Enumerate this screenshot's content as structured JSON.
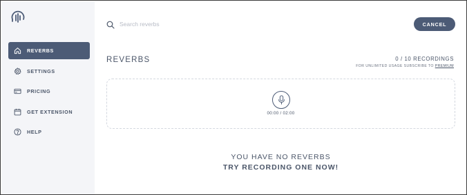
{
  "sidebar": {
    "logo_icon": "waveform-headset-icon",
    "items": [
      {
        "label": "REVERBS",
        "icon": "home-icon",
        "active": true
      },
      {
        "label": "SETTINGS",
        "icon": "gear-icon",
        "active": false
      },
      {
        "label": "PRICING",
        "icon": "credit-card-icon",
        "active": false
      },
      {
        "label": "GET EXTENSION",
        "icon": "calendar-icon",
        "active": false
      },
      {
        "label": "HELP",
        "icon": "question-circle-icon",
        "active": false
      }
    ]
  },
  "header": {
    "search_placeholder": "Search reverbs",
    "cancel_label": "CANCEL"
  },
  "main": {
    "title": "REVERBS",
    "recording_count": "0 / 10 RECORDINGS",
    "upsell_text": "FOR UNLIMITED USAGE SUBSCRIBE TO",
    "upsell_link": "PREMIUM",
    "recorder": {
      "mic_icon": "microphone-icon",
      "timer": "00:00 / 02:00"
    },
    "empty_line1": "YOU HAVE NO REVERBS",
    "empty_line2": "TRY RECORDING ONE NOW!"
  },
  "colors": {
    "accent": "#4c5b76",
    "sidebar_bg": "#f4f5f8",
    "text": "#4a5568"
  }
}
